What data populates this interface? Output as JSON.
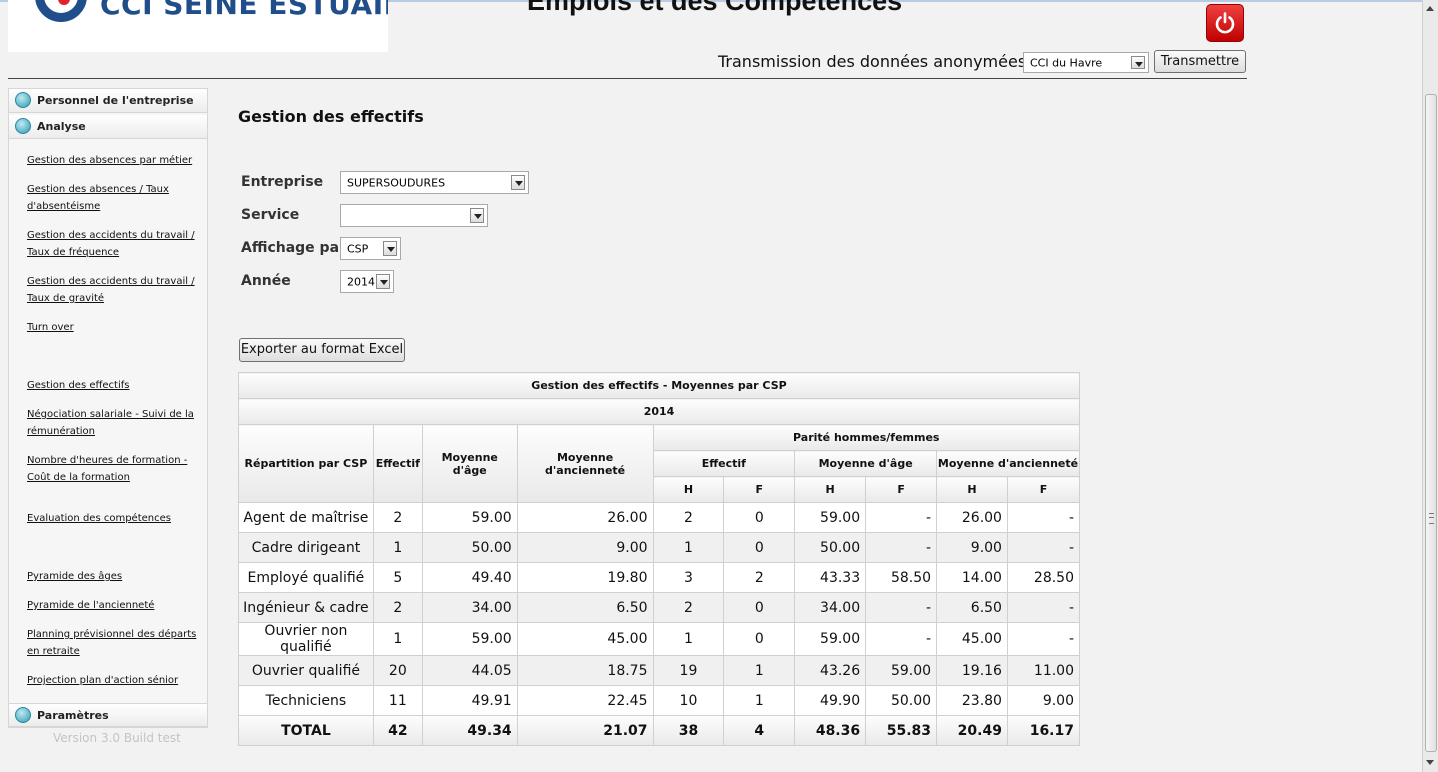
{
  "header": {
    "logo_text": "CCI SEINE ESTUAIRE",
    "app_title": "Emplois et des Compétences",
    "transmission_label": "Transmission des données anonymées",
    "cci_select_value": "CCI du Havre",
    "transmit_button": "Transmettre",
    "power_icon": "power-icon",
    "power_color": "#e02020"
  },
  "sidebar": {
    "sections": [
      {
        "label": "Personnel de l'entreprise",
        "icon": "expand-arrow-icon"
      },
      {
        "label": "Analyse",
        "icon": "collapse-arrow-icon"
      },
      {
        "label": "Paramètres",
        "icon": "expand-arrow-icon"
      }
    ],
    "links": [
      "Gestion des absences par métier",
      "Gestion des absences / Taux d'absentéisme",
      "Gestion des accidents du travail / Taux de fréquence",
      "Gestion des accidents du travail / Taux de gravité",
      "Turn over",
      "Gestion des effectifs",
      "Négociation salariale - Suivi de la rémunération",
      "Nombre d'heures de formation - Coût de la formation",
      "Evaluation des compétences",
      "Pyramide des âges",
      "Pyramide de l'ancienneté",
      "Planning prévisionnel des départs en retraite",
      "Projection plan d'action sénior"
    ],
    "version": "Version 3.0 Build test"
  },
  "main": {
    "title": "Gestion des effectifs",
    "form": {
      "entreprise_label": "Entreprise",
      "entreprise_value": "SUPERSOUDURES",
      "service_label": "Service",
      "service_value": "",
      "affichage_label": "Affichage par",
      "affichage_value": "CSP",
      "annee_label": "Année",
      "annee_value": "2014"
    },
    "export_button": "Exporter au format Excel",
    "table": {
      "caption": "Gestion des effectifs - Moyennes par CSP",
      "year": "2014",
      "headers": {
        "repartition": "Répartition par CSP",
        "effectif": "Effectif",
        "moyenne_age": "Moyenne d'âge",
        "moyenne_anciennete": "Moyenne d'ancienneté",
        "parite": "Parité hommes/femmes",
        "sub_effectif": "Effectif",
        "sub_age": "Moyenne d'âge",
        "sub_anciennete": "Moyenne d'ancienneté",
        "h": "H",
        "f": "F"
      },
      "rows": [
        [
          "Agent de maîtrise",
          "2",
          "59.00",
          "26.00",
          "2",
          "0",
          "59.00",
          "-",
          "26.00",
          "-"
        ],
        [
          "Cadre dirigeant",
          "1",
          "50.00",
          "9.00",
          "1",
          "0",
          "50.00",
          "-",
          "9.00",
          "-"
        ],
        [
          "Employé qualifié",
          "5",
          "49.40",
          "19.80",
          "3",
          "2",
          "43.33",
          "58.50",
          "14.00",
          "28.50"
        ],
        [
          "Ingénieur & cadre",
          "2",
          "34.00",
          "6.50",
          "2",
          "0",
          "34.00",
          "-",
          "6.50",
          "-"
        ],
        [
          "Ouvrier non qualifié",
          "1",
          "59.00",
          "45.00",
          "1",
          "0",
          "59.00",
          "-",
          "45.00",
          "-"
        ],
        [
          "Ouvrier qualifié",
          "20",
          "44.05",
          "18.75",
          "19",
          "1",
          "43.26",
          "59.00",
          "19.16",
          "11.00"
        ],
        [
          "Techniciens",
          "11",
          "49.91",
          "22.45",
          "10",
          "1",
          "49.90",
          "50.00",
          "23.80",
          "9.00"
        ]
      ],
      "total": [
        "TOTAL",
        "42",
        "49.34",
        "21.07",
        "38",
        "4",
        "48.36",
        "55.83",
        "20.49",
        "16.17"
      ]
    }
  }
}
